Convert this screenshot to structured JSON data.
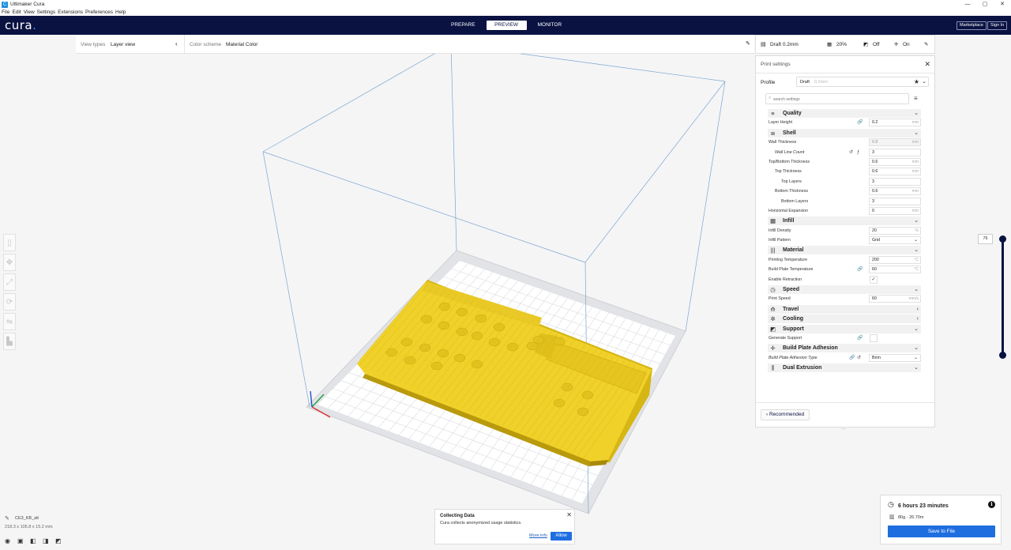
{
  "window": {
    "title": "Ultimaker Cura",
    "controls": [
      "—",
      "▢",
      "✕"
    ]
  },
  "menu": [
    "File",
    "Edit",
    "View",
    "Settings",
    "Extensions",
    "Preferences",
    "Help"
  ],
  "header": {
    "logo": "cura",
    "logo_dot": ".",
    "tabs": [
      "PREPARE",
      "PREVIEW",
      "MONITOR"
    ],
    "active_tab": "PREVIEW",
    "marketplace": "Marketplace",
    "sign_in": "Sign In"
  },
  "viewbar": {
    "view_types_label": "View types",
    "view_types_value": "Layer view",
    "color_scheme_label": "Color scheme",
    "color_scheme_value": "Material Color"
  },
  "printbar": {
    "profile": "Draft 0.2mm",
    "infill": "20%",
    "support": "Off",
    "adhesion": "On"
  },
  "panel": {
    "title": "Print settings",
    "profile_label": "Profile",
    "profile_name": "Draft",
    "profile_layer": "0.2mm",
    "search_placeholder": "search settings",
    "recommended": "Recommended"
  },
  "settings": [
    {
      "type": "cat",
      "name": "Quality",
      "icon": "≡",
      "chev": "⌄"
    },
    {
      "type": "row",
      "name": "Layer Height",
      "indent": 0,
      "value": "0.2",
      "unit": "mm",
      "icons": [
        "link"
      ]
    },
    {
      "type": "cat",
      "name": "Shell",
      "icon": "⧈",
      "chev": "⌄"
    },
    {
      "type": "row",
      "name": "Wall Thickness",
      "indent": 0,
      "value": "0.8",
      "unit": "mm",
      "disabled": true
    },
    {
      "type": "row",
      "name": "Wall Line Count",
      "indent": 1,
      "value": "3",
      "unit": "",
      "italic": true,
      "icons": [
        "reset",
        "calc"
      ]
    },
    {
      "type": "row",
      "name": "Top/Bottom Thickness",
      "indent": 0,
      "value": "0.6",
      "unit": "mm"
    },
    {
      "type": "row",
      "name": "Top Thickness",
      "indent": 1,
      "value": "0.6",
      "unit": "mm"
    },
    {
      "type": "row",
      "name": "Top Layers",
      "indent": 2,
      "value": "3",
      "unit": ""
    },
    {
      "type": "row",
      "name": "Bottom Thickness",
      "indent": 1,
      "value": "0.6",
      "unit": "mm"
    },
    {
      "type": "row",
      "name": "Bottom Layers",
      "indent": 2,
      "value": "3",
      "unit": ""
    },
    {
      "type": "row",
      "name": "Horizontal Expansion",
      "indent": 0,
      "value": "0",
      "unit": "mm"
    },
    {
      "type": "cat",
      "name": "Infill",
      "icon": "▦",
      "chev": "⌄"
    },
    {
      "type": "row",
      "name": "Infill Density",
      "indent": 0,
      "value": "20",
      "unit": "%"
    },
    {
      "type": "row",
      "name": "Infill Pattern",
      "indent": 0,
      "value": "Grid",
      "unit": "",
      "dropdown": true
    },
    {
      "type": "cat",
      "name": "Material",
      "icon": "|||",
      "chev": "⌄"
    },
    {
      "type": "row",
      "name": "Printing Temperature",
      "indent": 0,
      "value": "200",
      "unit": "°C"
    },
    {
      "type": "row",
      "name": "Build Plate Temperature",
      "indent": 0,
      "value": "60",
      "unit": "°C",
      "icons": [
        "link"
      ]
    },
    {
      "type": "row",
      "name": "Enable Retraction",
      "indent": 0,
      "checkbox": true,
      "checked": true
    },
    {
      "type": "cat",
      "name": "Speed",
      "icon": "◷",
      "chev": "⌄"
    },
    {
      "type": "row",
      "name": "Print Speed",
      "indent": 0,
      "value": "60",
      "unit": "mm/s"
    },
    {
      "type": "cat",
      "name": "Travel",
      "icon": "⟰",
      "chev": "‹"
    },
    {
      "type": "cat",
      "name": "Cooling",
      "icon": "✲",
      "chev": "‹"
    },
    {
      "type": "cat",
      "name": "Support",
      "icon": "◩",
      "chev": "⌄"
    },
    {
      "type": "row",
      "name": "Generate Support",
      "indent": 0,
      "checkbox": true,
      "checked": false,
      "icons": [
        "link"
      ]
    },
    {
      "type": "cat",
      "name": "Build Plate Adhesion",
      "icon": "✛",
      "chev": "⌄"
    },
    {
      "type": "row",
      "name": "Build Plate Adhesion Type",
      "indent": 0,
      "value": "Brim",
      "unit": "",
      "dropdown": true,
      "italic": true,
      "icons": [
        "link",
        "reset"
      ]
    },
    {
      "type": "cat",
      "name": "Dual Extrusion",
      "icon": "⫼",
      "chev": "⌄"
    }
  ],
  "layer_slider": {
    "value": "76"
  },
  "object": {
    "name": "CE3_KB_alt",
    "dimensions": "218.3 x 105.8 x 15.2 mm"
  },
  "collect": {
    "heading": "Collecting Data",
    "body": "Cura collects anonymized usage statistics.",
    "more_info": "More info",
    "allow": "Allow"
  },
  "estimate": {
    "time": "6 hours 23 minutes",
    "material": "80g · 26.70m",
    "save": "Save to File",
    "info_glyph": "i"
  },
  "colors": {
    "header_bg": "#0a1242",
    "accent": "#1e6ee0",
    "model": "#f0d12a"
  }
}
